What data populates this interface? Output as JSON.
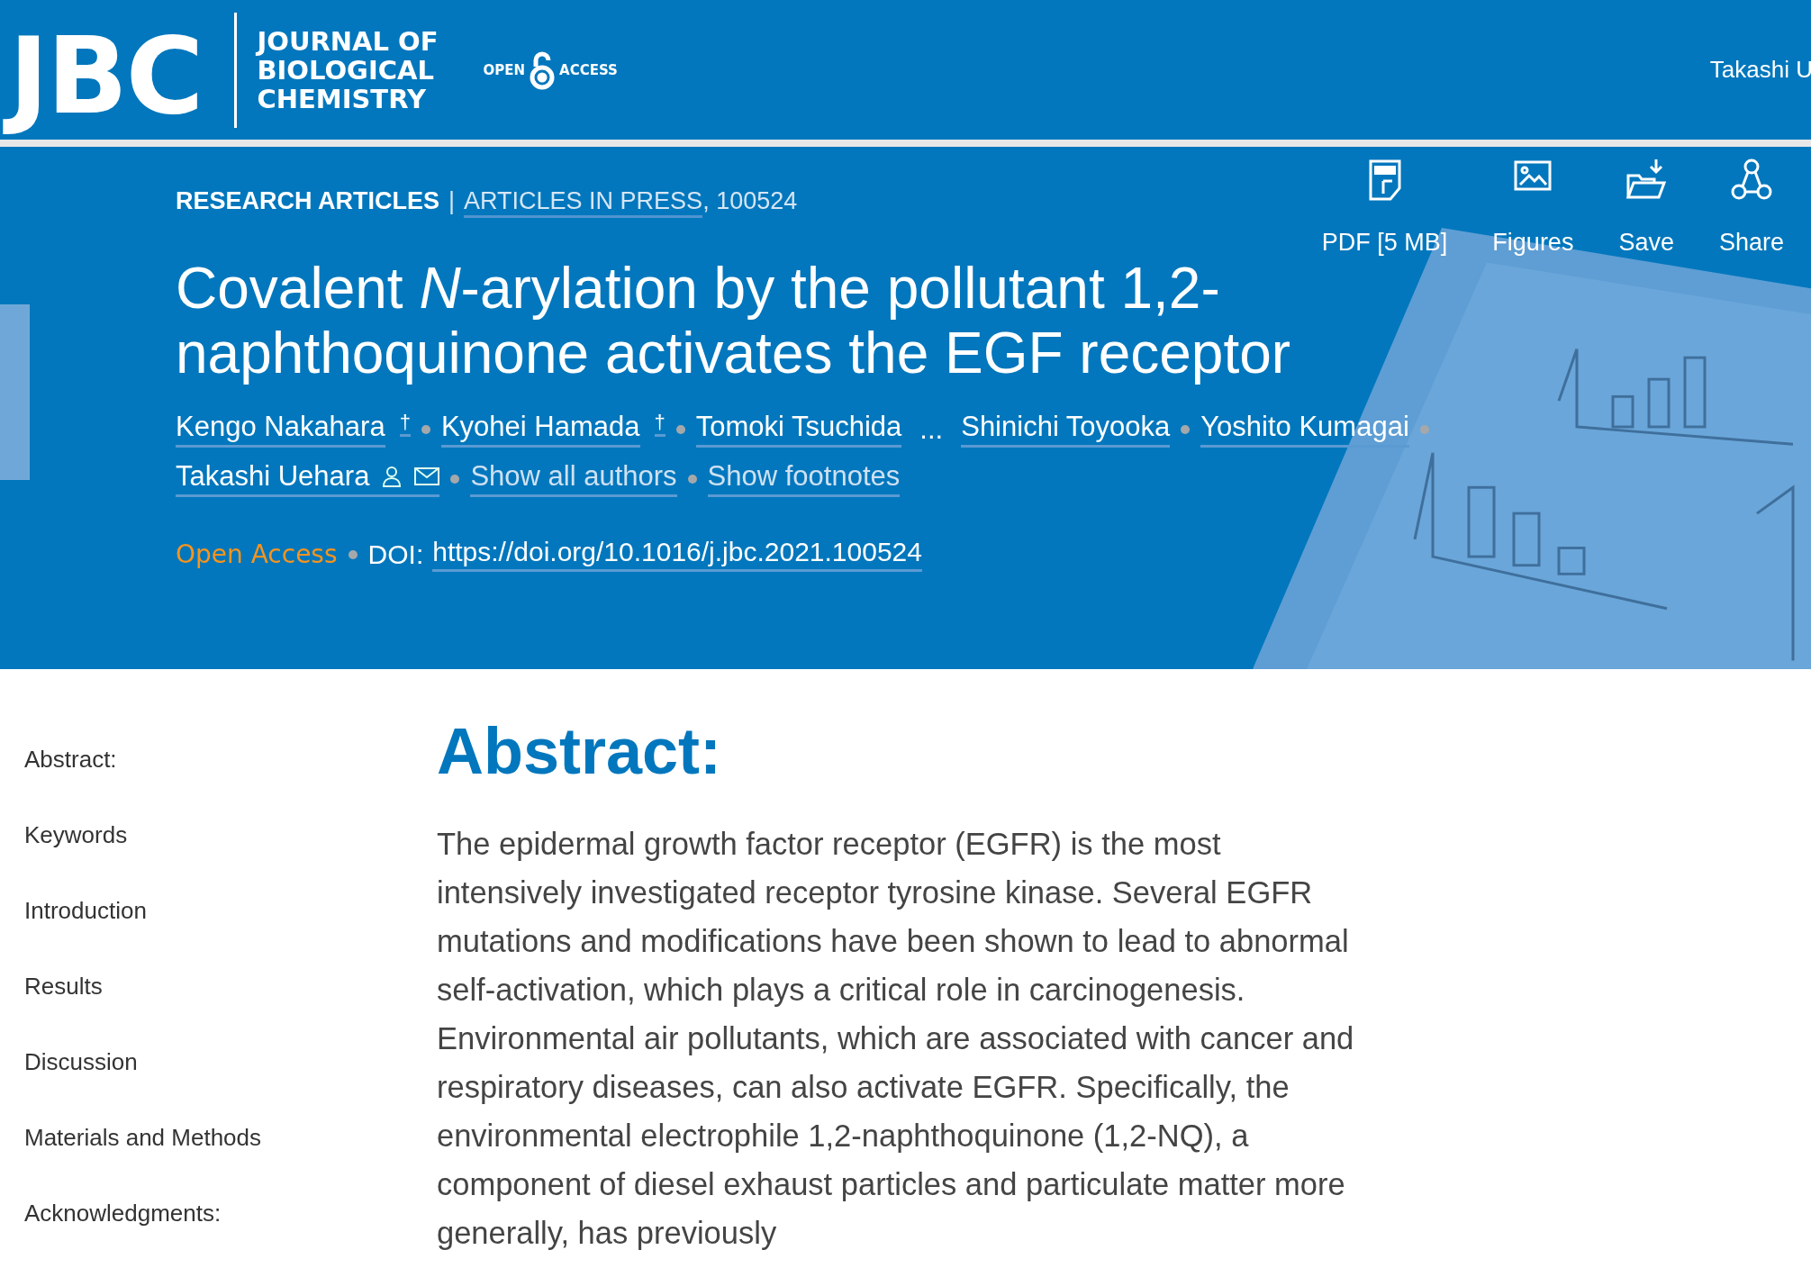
{
  "site_header": {
    "logo": {
      "mark": "JBC",
      "name_lines": [
        "JOURNAL OF",
        "BIOLOGICAL",
        "CHEMISTRY"
      ]
    },
    "open_access_badge": {
      "left": "OPEN",
      "right": "ACCESS"
    },
    "user_name": "Takashi U"
  },
  "article_header": {
    "section": "RESEARCH ARTICLES",
    "separator": "|",
    "issue_link": "ARTICLES IN PRESS",
    "article_number": ", 100524",
    "tools": [
      {
        "kind": "pdf",
        "label": "PDF [5 MB]"
      },
      {
        "kind": "figures",
        "label": "Figures"
      },
      {
        "kind": "save",
        "label": "Save"
      },
      {
        "kind": "share",
        "label": "Share"
      }
    ],
    "title": "Covalent *N*-arylation by the pollutant 1,2-naphthoquinone activates the EGF receptor",
    "authors": [
      {
        "kind": "author",
        "name": "Kengo Nakahara",
        "footnote_mark": "†",
        "corresponding": false
      },
      {
        "kind": "author",
        "name": "Kyohei Hamada",
        "footnote_mark": "†",
        "corresponding": false
      },
      {
        "kind": "author",
        "name": "Tomoki Tsuchida",
        "corresponding": false
      },
      {
        "kind": "ellipsis",
        "name": "..."
      },
      {
        "kind": "author",
        "name": "Shinichi Toyooka",
        "corresponding": false
      },
      {
        "kind": "author",
        "name": "Yoshito Kumagai",
        "corresponding": false
      },
      {
        "kind": "author",
        "name": "Takashi Uehara",
        "corresponding": true
      },
      {
        "kind": "link",
        "name": "Show all authors"
      },
      {
        "kind": "link",
        "name": "Show footnotes"
      }
    ],
    "access": "Open Access",
    "doi_label": "DOI:",
    "doi_link": "https://doi.org/10.1016/j.jbc.2021.100524"
  },
  "sidebar": {
    "items": [
      "Abstract:",
      "Keywords",
      "Introduction",
      "Results",
      "Discussion",
      "Materials and Methods",
      "Acknowledgments:"
    ]
  },
  "abstract": {
    "heading": "Abstract:",
    "text": "The epidermal growth factor receptor (EGFR) is the most intensively investigated receptor tyrosine kinase. Several EGFR mutations and modifications have been shown to lead to abnormal self-activation, which plays a critical role in carcinogenesis. Environmental air pollutants, which are associated with cancer and respiratory diseases, can also activate EGFR. Specifically, the environmental electrophile 1,2-naphthoquinone (1,2-NQ), a component of diesel exhaust particles and particulate matter more generally, has previously"
  }
}
